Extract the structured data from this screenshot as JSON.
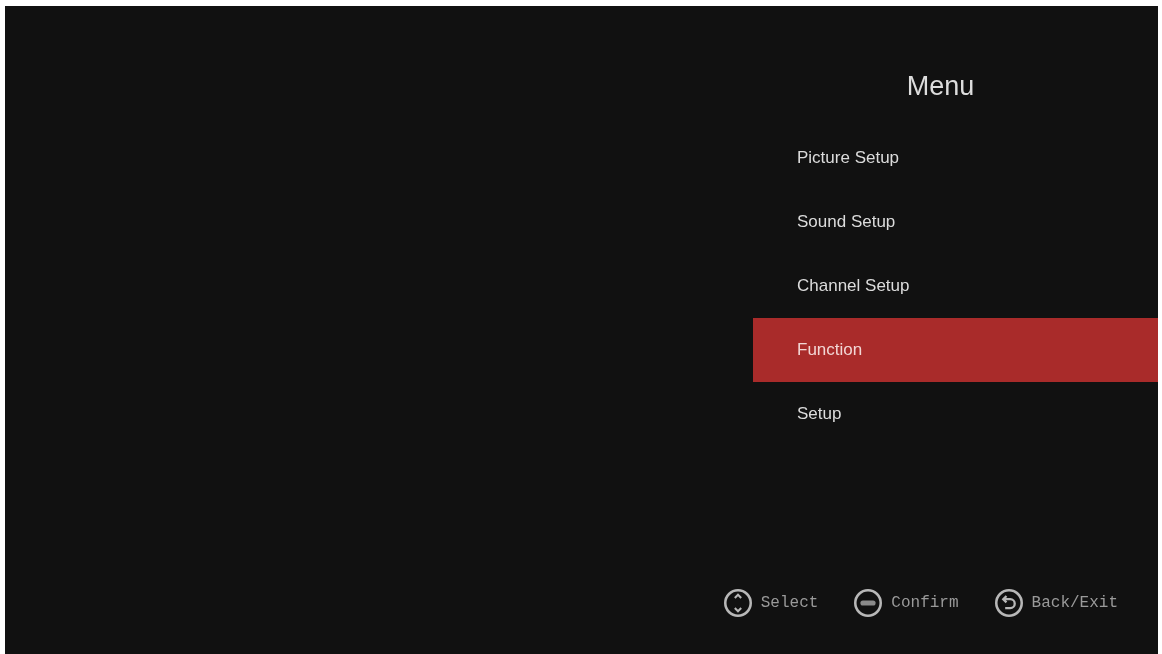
{
  "menu": {
    "title": "Menu",
    "items": [
      {
        "label": "Picture Setup",
        "selected": false
      },
      {
        "label": "Sound Setup",
        "selected": false
      },
      {
        "label": "Channel Setup",
        "selected": false
      },
      {
        "label": "Function",
        "selected": true
      },
      {
        "label": "Setup",
        "selected": false
      }
    ]
  },
  "hints": [
    {
      "kind": "updown",
      "label": "Select"
    },
    {
      "kind": "ok",
      "label": "Confirm"
    },
    {
      "kind": "back",
      "label": "Back/Exit"
    }
  ]
}
